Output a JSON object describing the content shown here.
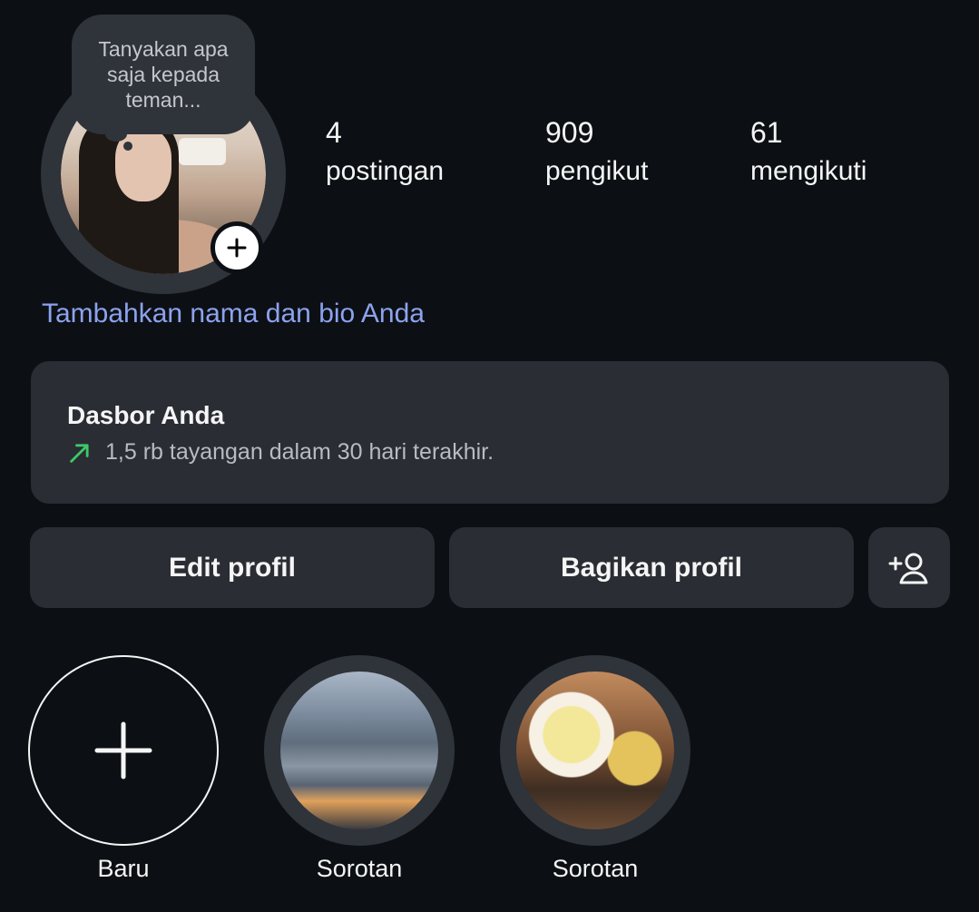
{
  "note": {
    "text": "Tanyakan apa saja kepada teman..."
  },
  "stats": [
    {
      "value": "4",
      "label": "postingan"
    },
    {
      "value": "909",
      "label": "pengikut"
    },
    {
      "value": "61",
      "label": "mengikuti"
    }
  ],
  "bio_prompt": "Tambahkan nama dan bio Anda",
  "dashboard": {
    "title": "Dasbor Anda",
    "subtitle": "1,5 rb tayangan dalam 30 hari terakhir.",
    "trend_color": "#3ec96a"
  },
  "buttons": {
    "edit": "Edit profil",
    "share": "Bagikan profil"
  },
  "highlights": [
    {
      "label": "Baru"
    },
    {
      "label": "Sorotan"
    },
    {
      "label": "Sorotan"
    }
  ],
  "colors": {
    "background": "#0c1014",
    "card": "#2a2d33",
    "link": "#8da2ee"
  }
}
